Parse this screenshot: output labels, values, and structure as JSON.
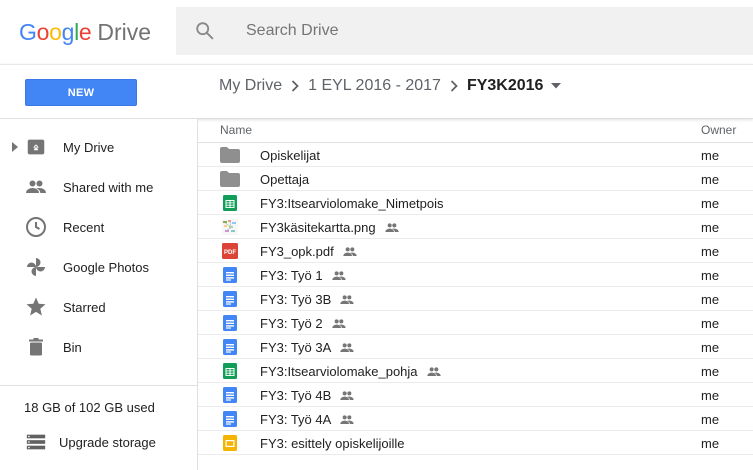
{
  "header": {
    "logo_google": [
      "G",
      "o",
      "o",
      "g",
      "l",
      "e"
    ],
    "logo_google_colors": [
      "#4285f4",
      "#ea4335",
      "#fbbc05",
      "#4285f4",
      "#34a853",
      "#ea4335"
    ],
    "logo_drive": "Drive",
    "search_placeholder": "Search Drive",
    "search_icon": "search-icon"
  },
  "toolbar": {
    "new_label": "NEW",
    "breadcrumb": [
      "My Drive",
      "1 EYL 2016 - 2017"
    ],
    "current_folder": "FY3K2016"
  },
  "sidebar": {
    "items": [
      {
        "label": "My Drive",
        "icon": "drive-icon"
      },
      {
        "label": "Shared with me",
        "icon": "people-icon"
      },
      {
        "label": "Recent",
        "icon": "clock-icon"
      },
      {
        "label": "Google Photos",
        "icon": "photos-icon"
      },
      {
        "label": "Starred",
        "icon": "star-icon"
      },
      {
        "label": "Bin",
        "icon": "trash-icon"
      }
    ],
    "storage_text": "18 GB of 102 GB used",
    "upgrade_label": "Upgrade storage"
  },
  "list": {
    "col_name": "Name",
    "col_owner": "Owner",
    "files": [
      {
        "name": "Opiskelijat",
        "type": "folder",
        "shared": false,
        "owner": "me"
      },
      {
        "name": "Opettaja",
        "type": "folder",
        "shared": false,
        "owner": "me"
      },
      {
        "name": "FY3:Itsearviolomake_Nimetpois",
        "type": "sheet",
        "shared": false,
        "owner": "me"
      },
      {
        "name": "FY3käsitekartta.png",
        "type": "image",
        "shared": true,
        "owner": "me"
      },
      {
        "name": "FY3_opk.pdf",
        "type": "pdf",
        "shared": true,
        "owner": "me"
      },
      {
        "name": "FY3: Työ 1",
        "type": "doc",
        "shared": true,
        "owner": "me"
      },
      {
        "name": "FY3: Työ 3B",
        "type": "doc",
        "shared": true,
        "owner": "me"
      },
      {
        "name": "FY3: Työ 2",
        "type": "doc",
        "shared": true,
        "owner": "me"
      },
      {
        "name": "FY3: Työ 3A",
        "type": "doc",
        "shared": true,
        "owner": "me"
      },
      {
        "name": "FY3:Itsearviolomake_pohja",
        "type": "sheet",
        "shared": true,
        "owner": "me"
      },
      {
        "name": "FY3: Työ 4B",
        "type": "doc",
        "shared": true,
        "owner": "me"
      },
      {
        "name": "FY3: Työ 4A",
        "type": "doc",
        "shared": true,
        "owner": "me"
      },
      {
        "name": "FY3: esittely opiskelijoille",
        "type": "slides",
        "shared": false,
        "owner": "me"
      }
    ]
  },
  "colors": {
    "accent": "#4285f4",
    "sheet": "#0f9d58",
    "doc": "#4285f4",
    "pdf": "#db4437",
    "slides": "#f4b400",
    "folder": "#8f8f8f"
  }
}
